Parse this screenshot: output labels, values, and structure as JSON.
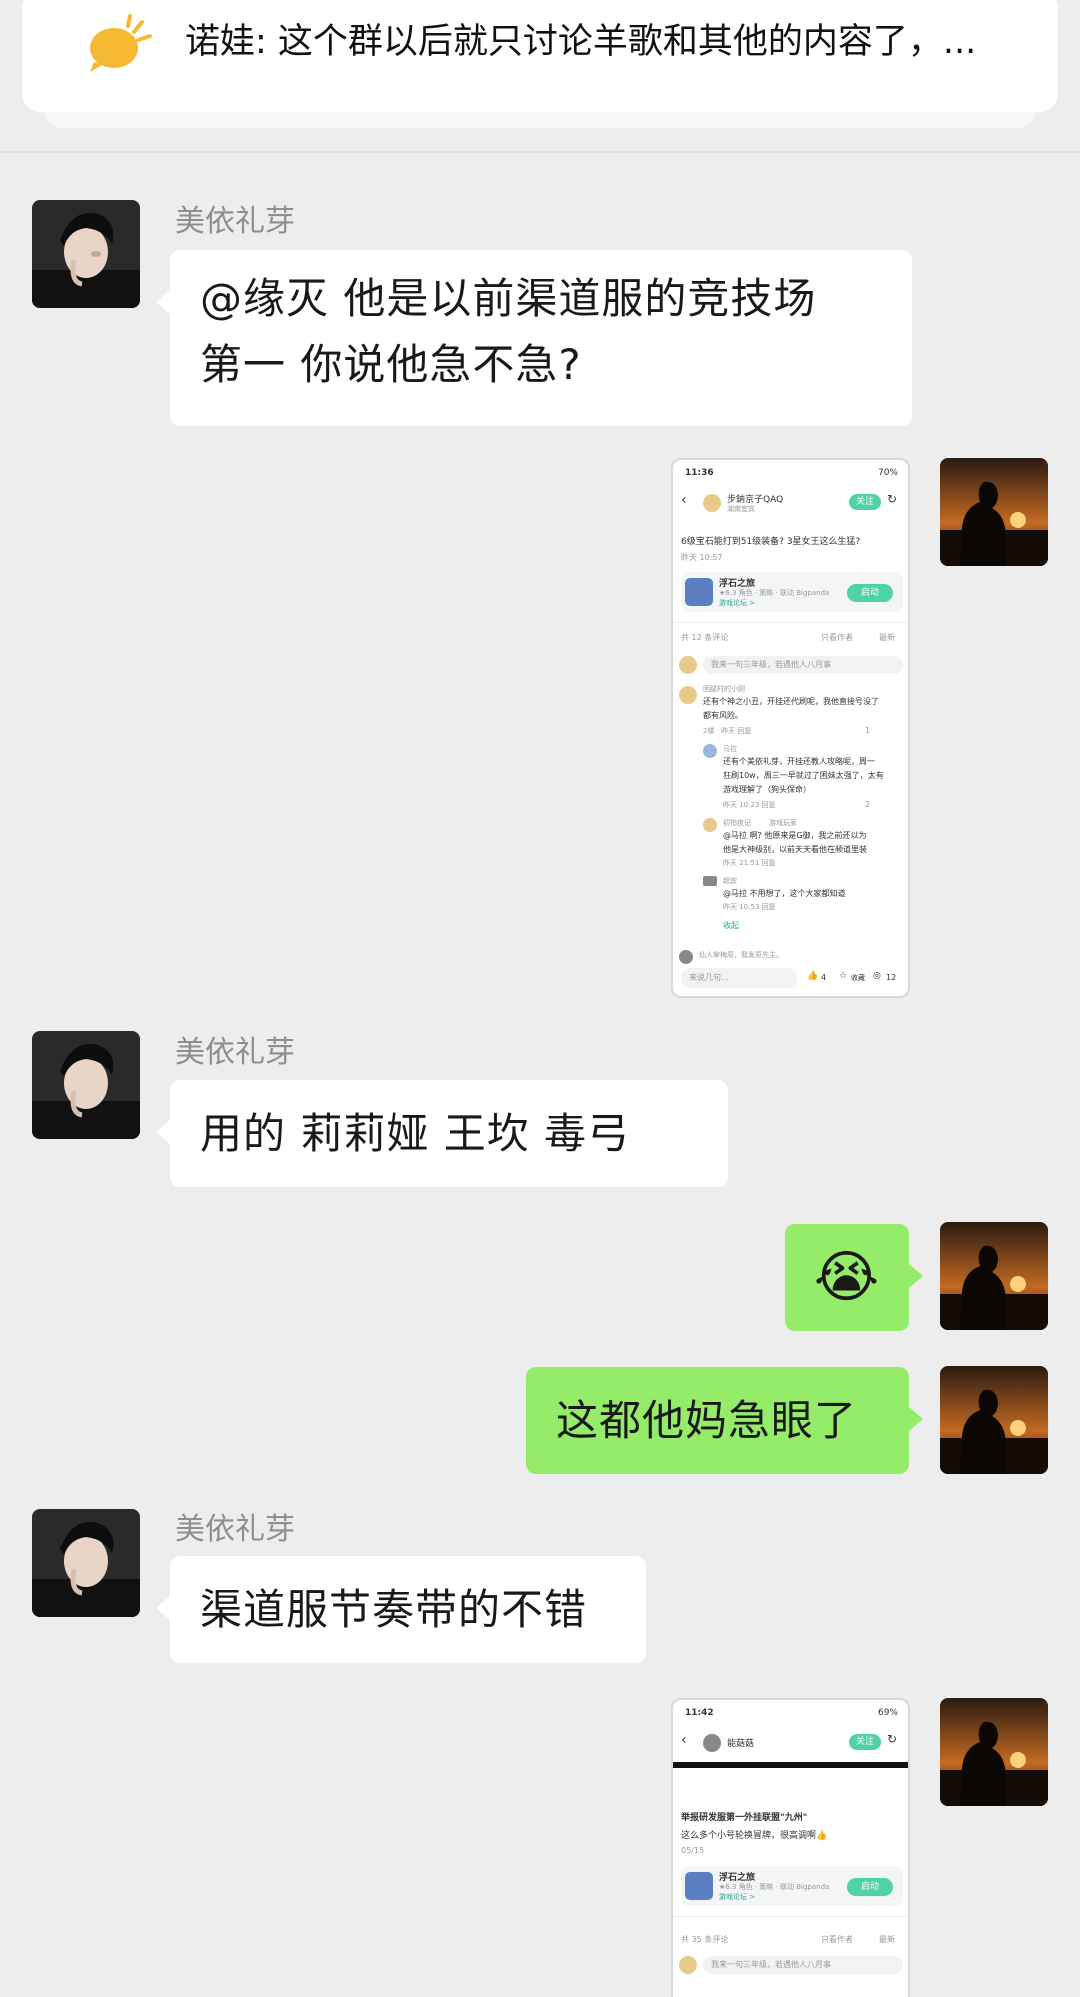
{
  "pinned": {
    "text": "诺娃: 这个群以后就只讨论羊歌和其他的内容了，..."
  },
  "messages": [
    {
      "sender": "美依礼芽",
      "text_line1": "@缘灭  他是以前渠道服的竞技场",
      "text_line2": "第一  你说他急不急?"
    },
    {
      "sender": "美依礼芽",
      "text": "用的  莉莉娅  王坎  毒弓"
    },
    {
      "emoji": "😭"
    },
    {
      "text": "这都他妈急眼了"
    },
    {
      "sender": "美依礼芽",
      "text": "渠道服节奏带的不错"
    }
  ],
  "shot1": {
    "time": "11:36",
    "battery": "70%",
    "user": "步鈉京子QAQ",
    "sub": "湖南宜宾",
    "follow": "关注",
    "title": "6级宝石能打到51级装备? 3星女王这么生猛?",
    "date": "昨天 10:57",
    "game_name": "浮石之旅",
    "game_meta": "★6.3  角色 · 策略 · 联动 Bigpanda",
    "game_link": "游戏论坛 >",
    "game_btn": "启动",
    "comments_count": "共 12 条评论",
    "only_author": "只看作者",
    "newest": "最新",
    "input_ph": "我来一句三年级，若遇他人八月事",
    "c1_user": "困腿村的小刚",
    "c1_text_1": "还有个神之小丑，开挂还代刷呢，我他直接号没了",
    "c1_text_2": "都有风险。",
    "c1_meta": "2楼 · 昨天  回复",
    "c1_likes": "1",
    "r1_user": "马拉",
    "r1_text_1": "还有个美依礼芽，开挂还教人攻略呢，周一",
    "r1_text_2": "狂刷10w，周三一早就过了困妹太强了，太有",
    "r1_text_3": "游戏理解了（狗头保命）",
    "r1_meta": "昨天 10:23  回复",
    "r1_likes": "2",
    "r2_user": "初指夜记",
    "r2_tag": "游戏玩家",
    "r2_text_1": "@马拉  啊? 他原来是G御，我之前还以为",
    "r2_text_2": "他是大神级别，以前天天看他在频道里装",
    "r2_meta": "昨天 21:51  回复",
    "r3_user": "超宾",
    "r3_text": "@马拉  不用想了，这个大家都知道",
    "r3_meta": "昨天 10:53  回复",
    "collapse": "收起",
    "bottom_user": "仙人掌梅原，我发原先主。",
    "bottom_input": "来说几句...",
    "likes": "4",
    "collect": "收藏",
    "comments": "12"
  },
  "shot2": {
    "time": "11:42",
    "battery": "69%",
    "user": "能菇菇",
    "follow": "关注",
    "title": "举报研发服第一外挂联盟\"九州\"",
    "line2": "这么多个小号轮换冒牌，很高调啊👍",
    "date": "05/15",
    "game_name": "浮石之旅",
    "game_meta": "★6.3  角色 · 策略 · 联动 Bigpanda",
    "game_link": "游戏论坛 >",
    "game_btn": "启动",
    "comments_count": "共 35 条评论",
    "only_author": "只看作者",
    "newest": "最新",
    "input_ph": "我来一句三年级，若遇他人八月事"
  },
  "colors": {
    "background": "#ededed",
    "bubble_white": "#ffffff",
    "bubble_green": "#95ec69",
    "name_gray": "#8e8e8e",
    "accent": "#4fd2a8"
  },
  "icons": {
    "pinned": "megaphone-icon",
    "emoji": "loudly-crying-face"
  }
}
